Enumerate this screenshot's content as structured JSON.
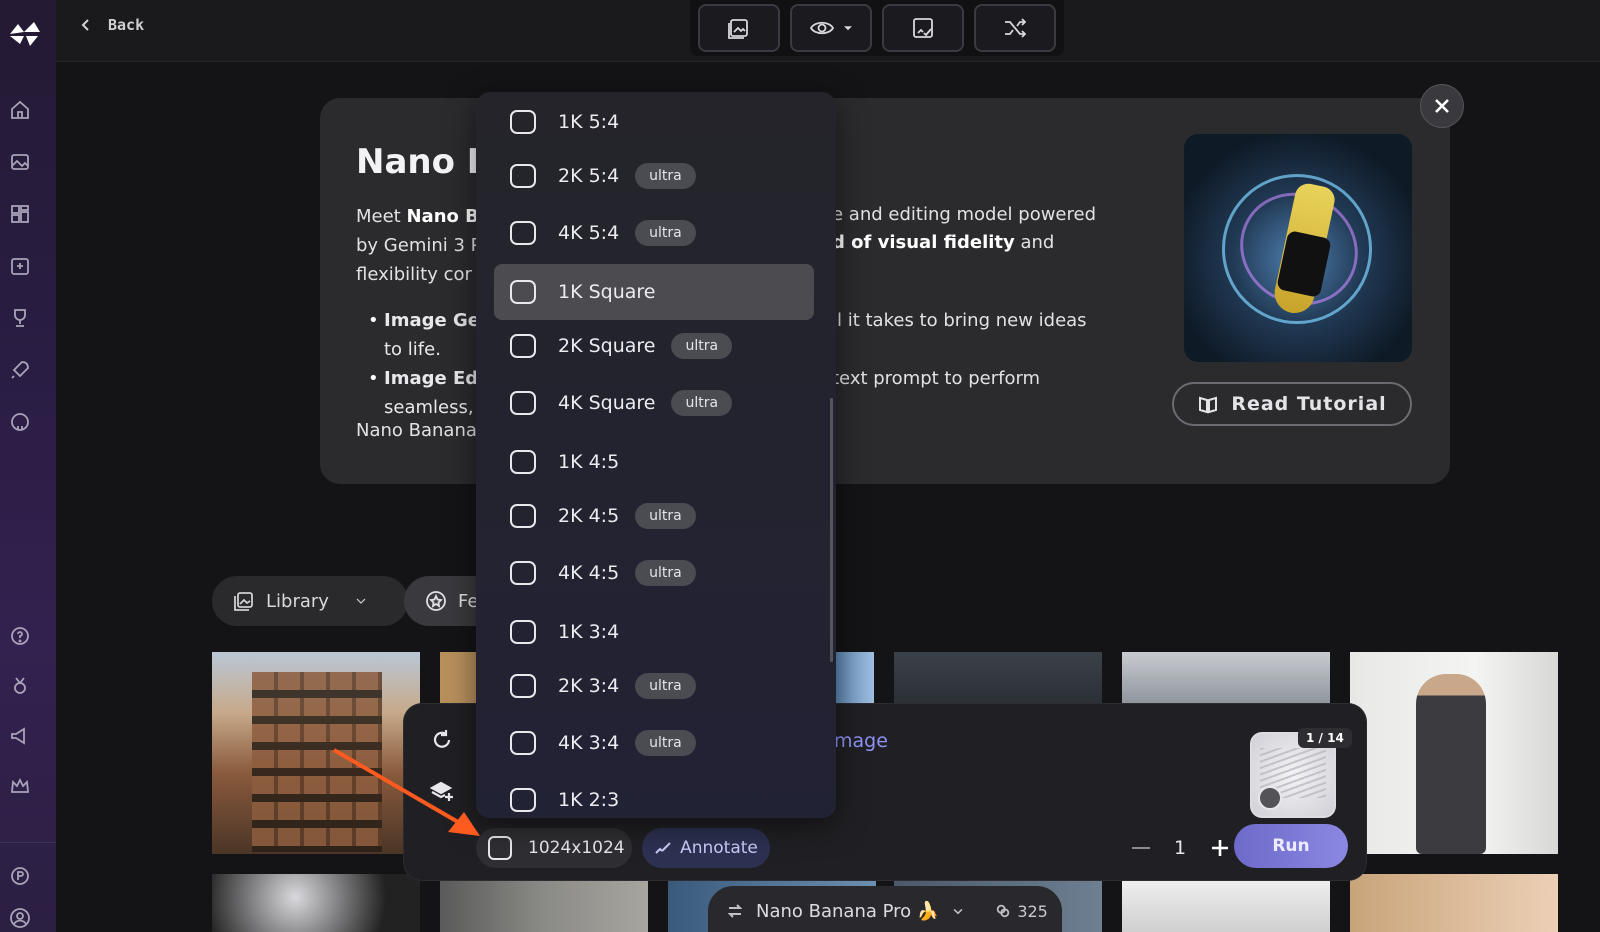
{
  "topbar": {
    "back_label": "Back"
  },
  "card": {
    "title": "Nano B",
    "intro_left_1": "Meet",
    "intro_left_bold": "Nano B",
    "intro_left_2": "by Gemini 3 P",
    "intro_left_3": "flexibility cor",
    "intro_right_1": "e and editing model powered",
    "intro_right_2_bold": "d of visual fidelity",
    "intro_right_2": "and",
    "bullet1_bold": "Image Ger",
    "bullet1_cont": "to life.",
    "bullet1_right": "ll it takes to bring new ideas",
    "bullet2_bold": "Image Edit",
    "bullet2_cont": "seamless,",
    "bullet2_right": "text prompt to perform",
    "footer": "Nano Banana",
    "read_tutorial_label": "Read Tutorial"
  },
  "filters": {
    "library_label": "Library",
    "featured_label": "Fe"
  },
  "dropdown": {
    "items": [
      {
        "label": "1K 5:4",
        "badge": ""
      },
      {
        "label": "2K 5:4",
        "badge": "ultra"
      },
      {
        "label": "4K 5:4",
        "badge": "ultra"
      },
      {
        "label": "1K Square",
        "badge": ""
      },
      {
        "label": "2K Square",
        "badge": "ultra"
      },
      {
        "label": "4K Square",
        "badge": "ultra"
      },
      {
        "label": "1K 4:5",
        "badge": ""
      },
      {
        "label": "2K 4:5",
        "badge": "ultra"
      },
      {
        "label": "4K 4:5",
        "badge": "ultra"
      },
      {
        "label": "1K 3:4",
        "badge": ""
      },
      {
        "label": "2K 3:4",
        "badge": "ultra"
      },
      {
        "label": "4K 3:4",
        "badge": "ultra"
      },
      {
        "label": "1K 2:3",
        "badge": ""
      }
    ]
  },
  "prompt": {
    "image_link_text": "mage",
    "preview_counter": "1 / 14",
    "size_label": "1024x1024",
    "annotate_label": "Annotate",
    "count": "1",
    "run_label": "Run"
  },
  "model": {
    "name": "Nano Banana Pro 🍌",
    "credits": "325"
  },
  "colors": {
    "accent": "#8b87e2",
    "annotate_bg": "#2d3152",
    "arrow": "#ff5a1f"
  }
}
